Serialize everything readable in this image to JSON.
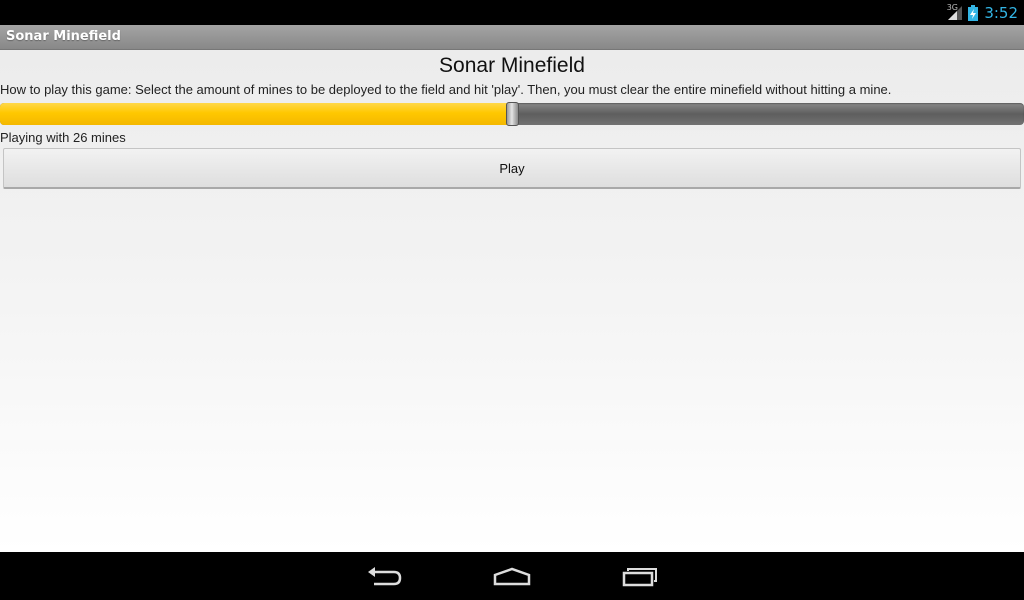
{
  "status_bar": {
    "network_type": "3G",
    "time": "3:52",
    "clock_color": "#33b5e5"
  },
  "action_bar": {
    "title": "Sonar Minefield"
  },
  "main": {
    "heading": "Sonar Minefield",
    "instructions": "How to play this game: Select the amount of mines to be deployed to the field and hit 'play'. Then, you must clear the entire minefield without hitting a mine.",
    "mine_slider": {
      "fraction": 0.5,
      "fill_color": "#ffc800"
    },
    "mine_count_label": "Playing with 26 mines",
    "play_label": "Play"
  },
  "navigation_bar": {
    "icons": [
      "back-icon",
      "home-icon",
      "recent-apps-icon"
    ]
  }
}
